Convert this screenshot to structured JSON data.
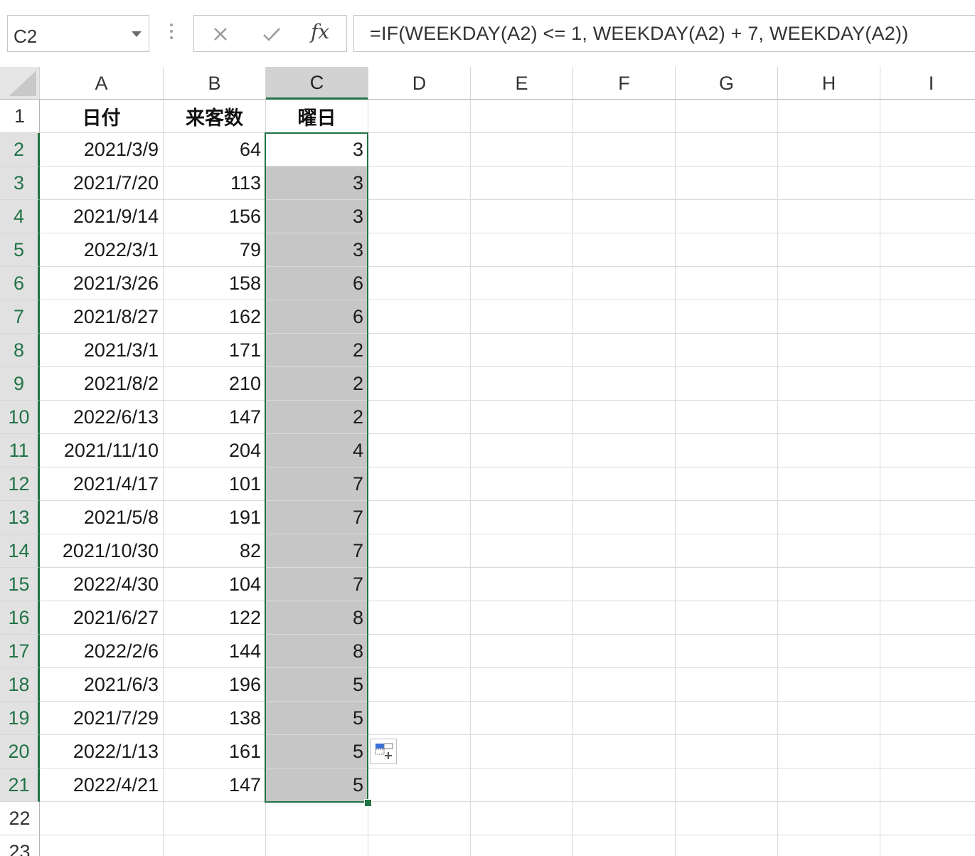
{
  "name_box": {
    "value": "C2"
  },
  "formula_bar": {
    "fx_label": "fx",
    "formula": "=IF(WEEKDAY(A2) <= 1, WEEKDAY(A2) + 7, WEEKDAY(A2))"
  },
  "columns": [
    "A",
    "B",
    "C",
    "D",
    "E",
    "F",
    "G",
    "H",
    "I"
  ],
  "selected_column": "C",
  "header_row": {
    "row": "1",
    "a": "日付",
    "b": "来客数",
    "c": "曜日"
  },
  "rows": [
    {
      "row": "2",
      "a": "2021/3/9",
      "b": "64",
      "c": "3"
    },
    {
      "row": "3",
      "a": "2021/7/20",
      "b": "113",
      "c": "3"
    },
    {
      "row": "4",
      "a": "2021/9/14",
      "b": "156",
      "c": "3"
    },
    {
      "row": "5",
      "a": "2022/3/1",
      "b": "79",
      "c": "3"
    },
    {
      "row": "6",
      "a": "2021/3/26",
      "b": "158",
      "c": "6"
    },
    {
      "row": "7",
      "a": "2021/8/27",
      "b": "162",
      "c": "6"
    },
    {
      "row": "8",
      "a": "2021/3/1",
      "b": "171",
      "c": "2"
    },
    {
      "row": "9",
      "a": "2021/8/2",
      "b": "210",
      "c": "2"
    },
    {
      "row": "10",
      "a": "2022/6/13",
      "b": "147",
      "c": "2"
    },
    {
      "row": "11",
      "a": "2021/11/10",
      "b": "204",
      "c": "4"
    },
    {
      "row": "12",
      "a": "2021/4/17",
      "b": "101",
      "c": "7"
    },
    {
      "row": "13",
      "a": "2021/5/8",
      "b": "191",
      "c": "7"
    },
    {
      "row": "14",
      "a": "2021/10/30",
      "b": "82",
      "c": "7"
    },
    {
      "row": "15",
      "a": "2022/4/30",
      "b": "104",
      "c": "7"
    },
    {
      "row": "16",
      "a": "2021/6/27",
      "b": "122",
      "c": "8"
    },
    {
      "row": "17",
      "a": "2022/2/6",
      "b": "144",
      "c": "8"
    },
    {
      "row": "18",
      "a": "2021/6/3",
      "b": "196",
      "c": "5"
    },
    {
      "row": "19",
      "a": "2021/7/29",
      "b": "138",
      "c": "5"
    },
    {
      "row": "20",
      "a": "2022/1/13",
      "b": "161",
      "c": "5"
    },
    {
      "row": "21",
      "a": "2022/4/21",
      "b": "147",
      "c": "5"
    }
  ],
  "empty_rows": [
    "22",
    "23"
  ],
  "colors": {
    "accent": "#217346",
    "selection_fill": "#c6c6c6"
  }
}
